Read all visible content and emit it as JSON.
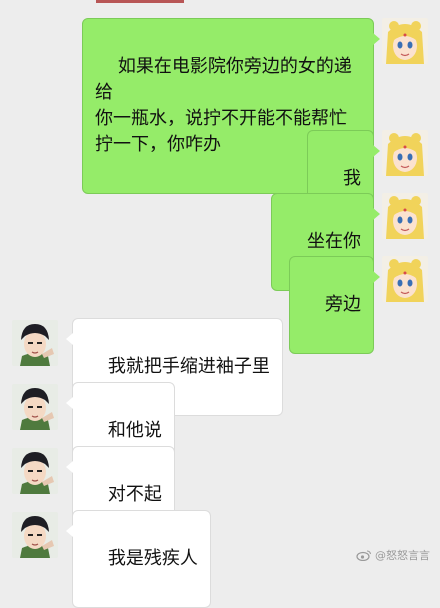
{
  "messages": [
    {
      "from": "me",
      "text": "如果在电影院你旁边的女的递给\n你一瓶水，说拧不开能不能帮忙\n拧一下，你咋办"
    },
    {
      "from": "me",
      "text": "我"
    },
    {
      "from": "me",
      "text": "坐在你"
    },
    {
      "from": "me",
      "text": "旁边"
    },
    {
      "from": "other",
      "text": "我就把手缩进袖子里"
    },
    {
      "from": "other",
      "text": "和他说"
    },
    {
      "from": "other",
      "text": "对不起"
    },
    {
      "from": "other",
      "text": "我是残疾人"
    }
  ],
  "avatars": {
    "me": "blonde-anime-girl-avatar",
    "other": "dark-haired-anime-boy-avatar"
  },
  "watermark": {
    "icon": "weibo-icon",
    "text": "@怒怒言言"
  },
  "colors": {
    "background": "#ededed",
    "my_bubble": "#95ec69",
    "other_bubble": "#ffffff"
  }
}
